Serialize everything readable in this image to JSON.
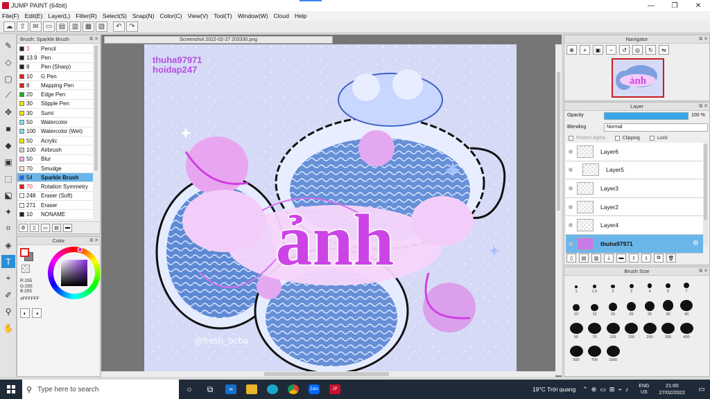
{
  "window": {
    "title": "JUMP PAINT (64bit)",
    "minimize": "—",
    "maximize": "❐",
    "close": "✕"
  },
  "menu": [
    "File(F)",
    "Edit(E)",
    "Layer(L)",
    "Filter(R)",
    "Select(S)",
    "Snap(N)",
    "Color(C)",
    "View(V)",
    "Tool(T)",
    "Window(W)",
    "Cloud",
    "Help"
  ],
  "brush_panel": {
    "title": "Brush: Sparkle Brush",
    "items": [
      {
        "size": "3",
        "name": "Pencil",
        "color": "#222222",
        "size_color": "#d33"
      },
      {
        "size": "13.9",
        "name": "Pen",
        "color": "#222222"
      },
      {
        "size": "8",
        "name": "Pen (Sharp)",
        "color": "#222222"
      },
      {
        "size": "10",
        "name": "G Pen",
        "color": "#e02020"
      },
      {
        "size": "8",
        "name": "Mapping Pen",
        "color": "#e02020"
      },
      {
        "size": "20",
        "name": "Edge Pen",
        "color": "#20b020"
      },
      {
        "size": "30",
        "name": "Stipple Pen",
        "color": "#f2e600"
      },
      {
        "size": "30",
        "name": "Sumi",
        "color": "#f2e600"
      },
      {
        "size": "50",
        "name": "Watercolor",
        "color": "#7fe0f0"
      },
      {
        "size": "100",
        "name": "Watercolor (Wet)",
        "color": "#7fe0f0"
      },
      {
        "size": "50",
        "name": "Acrylic",
        "color": "#f2e600"
      },
      {
        "size": "100",
        "name": "Airbrush",
        "color": "#d0d0d0"
      },
      {
        "size": "50",
        "name": "Blur",
        "color": "#f7a8e8"
      },
      {
        "size": "70",
        "name": "Smudge",
        "color": "#fde0c8"
      },
      {
        "size": "54",
        "name": "Sparkle Brush",
        "color": "#2266ee",
        "selected": true
      },
      {
        "size": "70",
        "name": "Rotation Symmetry",
        "color": "#e02020",
        "size_color": "#d33"
      },
      {
        "size": "248",
        "name": "Eraser (Soft)",
        "color": "#ffffff"
      },
      {
        "size": "271",
        "name": "Eraser",
        "color": "#ffffff"
      },
      {
        "size": "10",
        "name": "NONAME",
        "color": "#222222"
      }
    ]
  },
  "color_panel": {
    "title": "Color",
    "rgb": [
      "R:255",
      "G:255",
      "B:255"
    ],
    "hex": "#FFFFFF"
  },
  "canvas": {
    "doc_tab": "Screenshot 2022-02-27 203330.png",
    "watermark_1": "thuha97971",
    "watermark_2": "hoidap247",
    "art_text": "ảnh",
    "bottom_watermark": "@fresh_boba"
  },
  "navigator": {
    "title": "Navigator"
  },
  "layer_panel": {
    "title": "Layer",
    "opacity_label": "Opacity",
    "opacity_value": "100 %",
    "opacity_fraction": 1.0,
    "blending_label": "Blending",
    "blending_value": "Normal",
    "protect_alpha": "Protect Alpha",
    "clipping": "Clipping",
    "lock": "Lock",
    "layers": [
      {
        "name": "Layer6"
      },
      {
        "name": "Layer5",
        "child": true
      },
      {
        "name": "Layer3"
      },
      {
        "name": "Layer2"
      },
      {
        "name": "Layer4"
      },
      {
        "name": "thuha97971",
        "selected": true
      }
    ]
  },
  "brush_size": {
    "title": "Brush Size",
    "sizes": [
      "1",
      "1.5",
      "2",
      "3",
      "4",
      "5",
      "7",
      "10",
      "12",
      "15",
      "20",
      "25",
      "30",
      "40",
      "50",
      "70",
      "100",
      "150",
      "200",
      "300",
      "400",
      "500",
      "700",
      "1000"
    ]
  },
  "taskbar": {
    "search_placeholder": "Type here to search",
    "weather": "19°C  Trời quang",
    "lang_1": "ENG",
    "lang_2": "US",
    "time": "21:00",
    "date": "27/02/2022"
  }
}
